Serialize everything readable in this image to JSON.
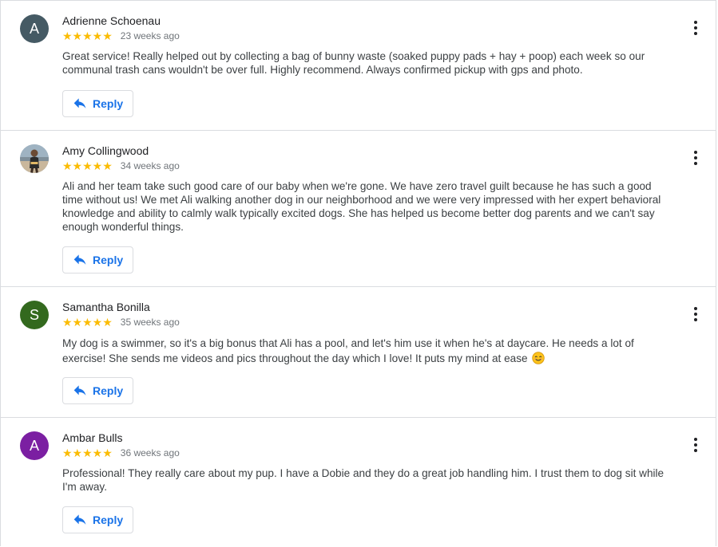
{
  "reviews": [
    {
      "name": "Adrienne Schoenau",
      "avatar_letter": "A",
      "avatar_color": "#455a64",
      "avatar_type": "letter",
      "stars": "★★★★★",
      "rating": 5,
      "time": "23 weeks ago",
      "text": "Great service! Really helped out by collecting a bag of bunny waste (soaked puppy pads + hay + poop) each week so our communal trash cans wouldn't be over full. Highly recommend. Always confirmed pickup with gps and photo.",
      "reply_label": "Reply"
    },
    {
      "name": "Amy Collingwood",
      "avatar_letter": "",
      "avatar_color": "#8d9aa6",
      "avatar_type": "photo",
      "stars": "★★★★★",
      "rating": 5,
      "time": "34 weeks ago",
      "text": "Ali and her team take such good care of our baby when we're gone. We have zero travel guilt because he has such a good time without us! We met Ali walking another dog in our neighborhood and we were very impressed with her expert behavioral knowledge and ability to calmly walk typically excited dogs. She has helped us become better dog parents and we can't say enough wonderful things.",
      "reply_label": "Reply"
    },
    {
      "name": "Samantha Bonilla",
      "avatar_letter": "S",
      "avatar_color": "#33691e",
      "avatar_type": "letter",
      "stars": "★★★★★",
      "rating": 5,
      "time": "35 weeks ago",
      "text": "My dog is a swimmer, so it's a big bonus that Ali has a pool, and let's him use it when he's at daycare. He needs a lot of exercise! She sends me videos and pics throughout the day which I love! It puts my mind at ease",
      "emoji": "smiling-face-emoji",
      "reply_label": "Reply"
    },
    {
      "name": "Ambar Bulls",
      "avatar_letter": "A",
      "avatar_color": "#7b1fa2",
      "avatar_type": "letter",
      "stars": "★★★★★",
      "rating": 5,
      "time": "36 weeks ago",
      "text": "Professional! They really care about my pup. I have a Dobie and they do a great job handling him. I trust them to dog sit while I'm away.",
      "reply_label": "Reply"
    }
  ],
  "colors": {
    "star": "#fbbc04",
    "link_blue": "#1a73e8",
    "divider": "#dadce0"
  },
  "icons": {
    "menu": "more-vert-icon",
    "reply": "reply-arrow-icon"
  }
}
